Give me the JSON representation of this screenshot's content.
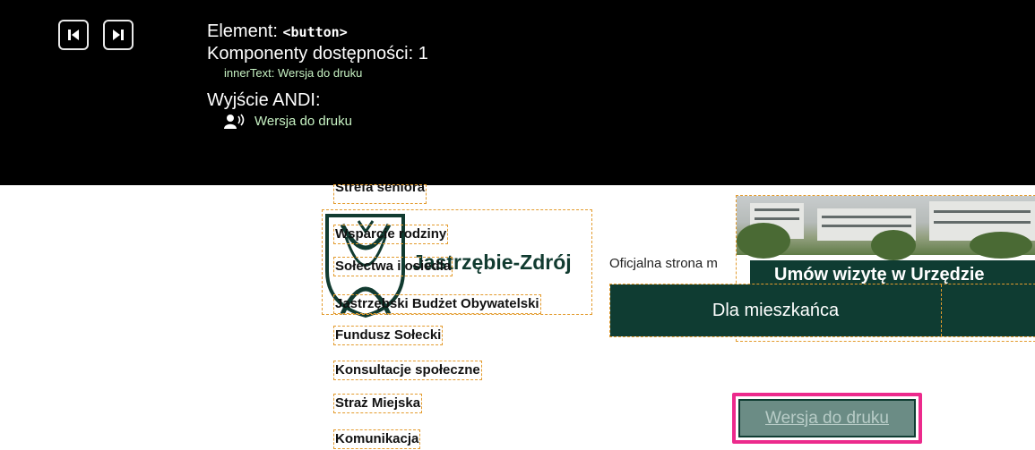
{
  "andi": {
    "prev_label": "Previous element",
    "next_label": "Next element",
    "element_prefix": "Element: ",
    "element_tag": "<button>",
    "components_label": "Komponenty dostępności: 1",
    "inner_text_line": "innerText: Wersja do druku",
    "output_title": "Wyjście ANDI:",
    "output_value": "Wersja do druku",
    "output_icon": "speaker-person-icon",
    "colors": {
      "background": "#000000",
      "highlight_text": "#c6f1c2",
      "focus_outline": "#ec2a8c"
    }
  },
  "side_menu": {
    "items": [
      "Strefa seniora",
      "Wsparcie rodziny",
      "Sołectwa i osiedla",
      "Jastrzębski Budżet Obywatelski",
      "Fundusz Sołecki",
      "Konsultacje społeczne",
      "Straż Miejska",
      "Komunikacja"
    ]
  },
  "logo": {
    "text": "Jastrzębie-Zdrój",
    "icon": "city-crest-icon",
    "color": "#113b30"
  },
  "header": {
    "tagline": "Oficjalna strona m"
  },
  "banner": {
    "text": "Umów wizytę w Urzędzie"
  },
  "nav": {
    "tab_residents": "Dla mieszkańca"
  },
  "print_button": {
    "label": "Wersja do druku"
  }
}
